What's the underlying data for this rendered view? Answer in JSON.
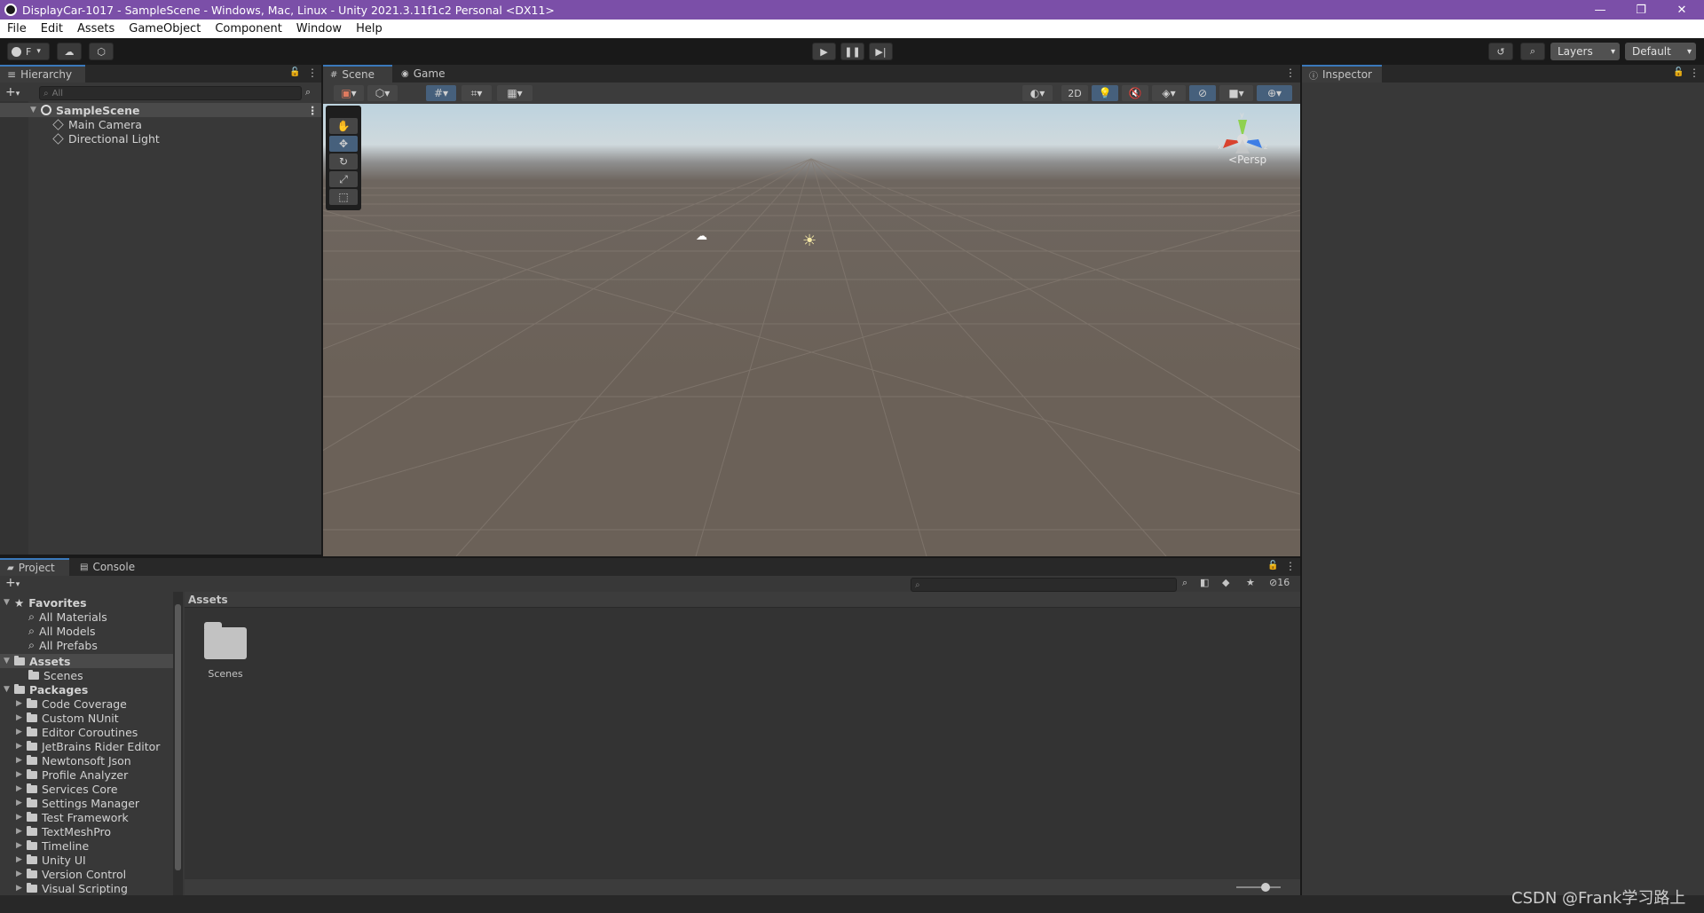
{
  "window": {
    "title": "DisplayCar-1017 - SampleScene - Windows, Mac, Linux - Unity 2021.3.11f1c2 Personal <DX11>",
    "controls": [
      "minimize-icon",
      "restore-icon",
      "close-icon"
    ]
  },
  "menu": [
    "File",
    "Edit",
    "Assets",
    "GameObject",
    "Component",
    "Window",
    "Help"
  ],
  "toolbar": {
    "account_label": "F",
    "play_icons": [
      "play-icon",
      "pause-icon",
      "step-icon"
    ],
    "layers_label": "Layers",
    "layout_label": "Default"
  },
  "hierarchy": {
    "tab": "Hierarchy",
    "search_placeholder": "All",
    "scene": "SampleScene",
    "items": [
      "Main Camera",
      "Directional Light"
    ]
  },
  "scene": {
    "tabs": [
      "Scene",
      "Game"
    ],
    "toolbar": {
      "mode_2d": "2D"
    },
    "persp_label": "Persp",
    "gizmo_axes": [
      "x",
      "y",
      "z"
    ]
  },
  "inspector": {
    "tab": "Inspector"
  },
  "project": {
    "tabs": [
      "Project",
      "Console"
    ],
    "favorites": {
      "label": "Favorites",
      "items": [
        "All Materials",
        "All Models",
        "All Prefabs"
      ]
    },
    "assets": {
      "label": "Assets",
      "items": [
        "Scenes"
      ]
    },
    "packages": {
      "label": "Packages",
      "items": [
        "Code Coverage",
        "Custom NUnit",
        "Editor Coroutines",
        "JetBrains Rider Editor",
        "Newtonsoft Json",
        "Profile Analyzer",
        "Services Core",
        "Settings Manager",
        "Test Framework",
        "TextMeshPro",
        "Timeline",
        "Unity UI",
        "Version Control",
        "Visual Scripting"
      ]
    },
    "breadcrumb": "Assets",
    "content": [
      {
        "name": "Scenes",
        "type": "folder"
      }
    ],
    "hidden_count": "16"
  },
  "watermark": "CSDN @Frank学习路上",
  "colors": {
    "titlebar": "#7b4fa8",
    "panel": "#383838",
    "accent": "#3a79bb"
  }
}
